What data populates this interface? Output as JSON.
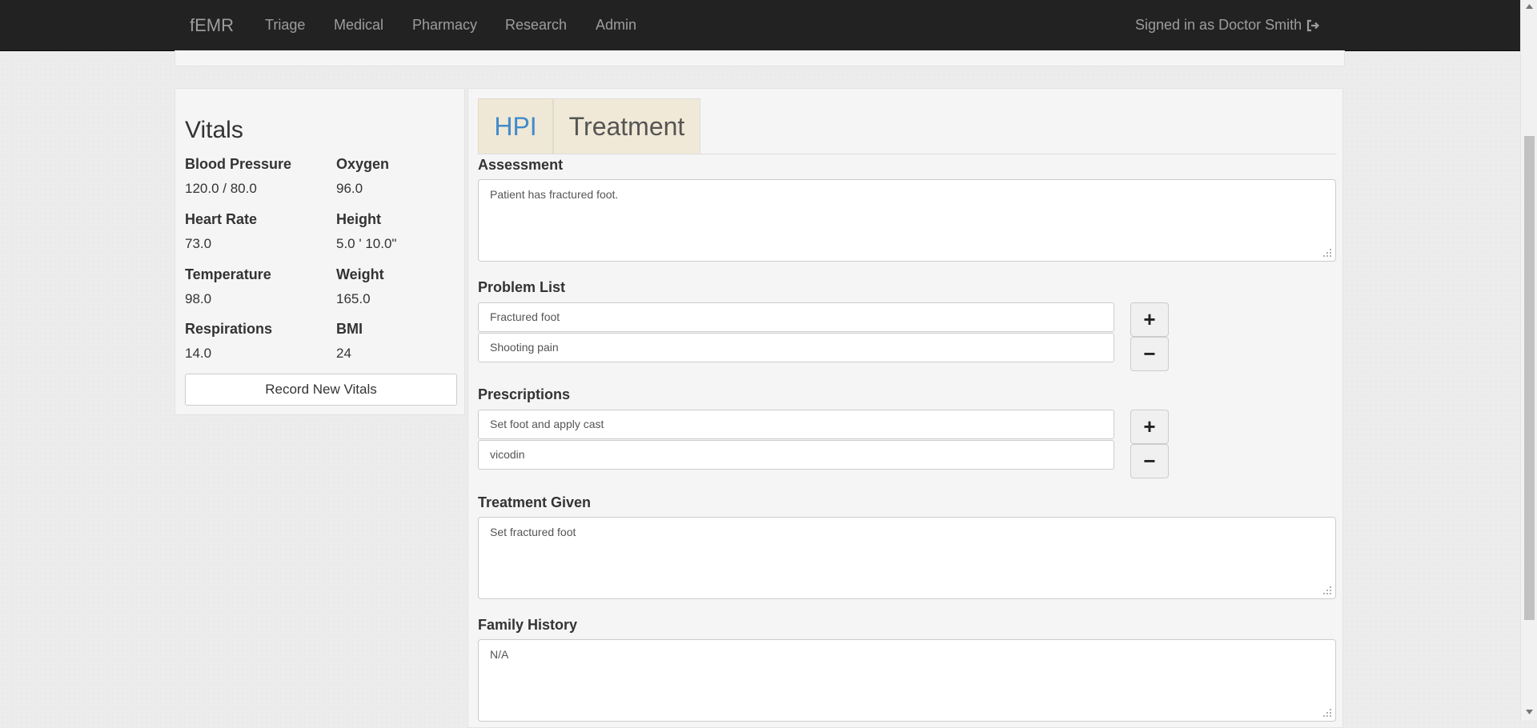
{
  "nav": {
    "brand": "fEMR",
    "items": [
      "Triage",
      "Medical",
      "Pharmacy",
      "Research",
      "Admin"
    ],
    "signed_in": "Signed in as Doctor Smith"
  },
  "vitals": {
    "title": "Vitals",
    "blood_pressure": {
      "label": "Blood Pressure",
      "value": "120.0 / 80.0"
    },
    "oxygen": {
      "label": "Oxygen",
      "value": "96.0"
    },
    "heart_rate": {
      "label": "Heart Rate",
      "value": "73.0"
    },
    "height": {
      "label": "Height",
      "value": "5.0 ' 10.0\""
    },
    "temperature": {
      "label": "Temperature",
      "value": "98.0"
    },
    "weight": {
      "label": "Weight",
      "value": "165.0"
    },
    "respirations": {
      "label": "Respirations",
      "value": "14.0"
    },
    "bmi": {
      "label": "BMI",
      "value": "24"
    },
    "record_button": "Record New Vitals"
  },
  "tabs": {
    "hpi": "HPI",
    "treatment": "Treatment"
  },
  "treatment": {
    "assessment": {
      "label": "Assessment",
      "value": "Patient has fractured foot."
    },
    "problem_list": {
      "label": "Problem List",
      "items": [
        "Fractured foot",
        "Shooting pain"
      ]
    },
    "prescriptions": {
      "label": "Prescriptions",
      "items": [
        "Set foot and apply cast",
        "vicodin"
      ]
    },
    "treatment_given": {
      "label": "Treatment Given",
      "value": "Set fractured foot"
    },
    "family_history": {
      "label": "Family History",
      "value": "N/A"
    }
  },
  "buttons": {
    "add": "+",
    "remove": "−"
  },
  "icons": {
    "sign_out": "sign-out-icon",
    "add": "plus-icon",
    "remove": "minus-icon"
  }
}
